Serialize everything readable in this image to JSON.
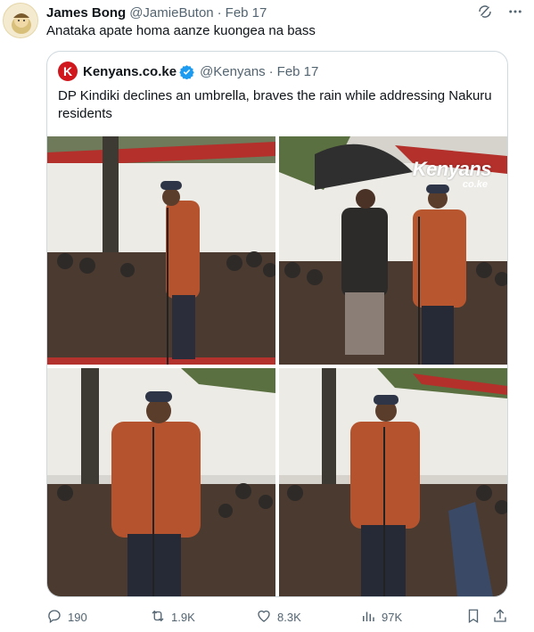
{
  "tweet": {
    "author_name": "James Bong",
    "author_handle": "@JamieButon",
    "separator": "·",
    "date": "Feb 17",
    "text": "Anataka apate homa aanze kuongea na bass",
    "header_icons": [
      "grok-icon",
      "more-icon"
    ]
  },
  "quote": {
    "logo_letter": "K",
    "author_name": "Kenyans.co.ke",
    "verified": true,
    "author_handle": "@Kenyans",
    "separator": "·",
    "date": "Feb 17",
    "text": "DP Kindiki declines an umbrella, braves the rain while addressing Nakuru residents",
    "watermark": "Kenyans",
    "watermark_sub": "co.ke"
  },
  "actions": {
    "replies": "190",
    "reposts": "1.9K",
    "likes": "8.3K",
    "views": "97K"
  },
  "colors": {
    "text": "#0f1419",
    "secondary": "#536471",
    "border": "#cfd9de",
    "brand_red": "#d0171d",
    "verified_blue": "#1d9bf0"
  }
}
